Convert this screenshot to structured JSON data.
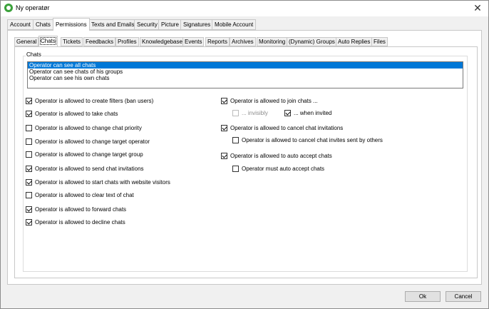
{
  "window": {
    "title": "Ny operatør"
  },
  "tabs": [
    "Account",
    "Chats",
    "Permissions",
    "Texts and Emails",
    "Security",
    "Picture",
    "Signatures",
    "Mobile Account"
  ],
  "subtabs": [
    "General",
    "Chats",
    "Tickets",
    "Feedbacks",
    "Profiles",
    "Knowledgebase",
    "Events",
    "Reports",
    "Archives",
    "Monitoring",
    "(Dynamic) Groups",
    "Auto Replies",
    "Files"
  ],
  "chats_group": {
    "label": "Chats",
    "list": [
      "Operator can see all chats",
      "Operator can see chats of his groups",
      "Operator can see his own chats"
    ],
    "selected_index": 0
  },
  "left_options": [
    {
      "label": "Operator is allowed to create filters (ban users)",
      "checked": true
    },
    {
      "label": "Operator is allowed to take chats",
      "checked": true
    },
    {
      "label": "Operator is allowed to change chat priority",
      "checked": false
    },
    {
      "label": "Operator is allowed to change target operator",
      "checked": false
    },
    {
      "label": "Operator is allowed to change target group",
      "checked": false
    },
    {
      "label": "Operator is allowed to send chat invitations",
      "checked": true
    },
    {
      "label": "Operator is allowed to start chats with website visitors",
      "checked": true
    },
    {
      "label": "Operator is allowed to clear text of chat",
      "checked": false
    },
    {
      "label": "Operator is allowed to forward chats",
      "checked": true
    },
    {
      "label": "Operator is allowed to decline chats",
      "checked": true
    }
  ],
  "right_options": {
    "join_chats": {
      "label": "Operator is allowed to join chats ...",
      "checked": true
    },
    "invisibly": {
      "label": "... invisibly",
      "checked": false,
      "disabled": true
    },
    "when_invited": {
      "label": "... when invited",
      "checked": true
    },
    "cancel_invitations": {
      "label": "Operator is allowed to cancel chat invitations",
      "checked": true
    },
    "cancel_by_others": {
      "label": "Operator is allowed to cancel chat invites sent by others",
      "checked": false
    },
    "auto_accept": {
      "label": "Operator is allowed to auto accept chats",
      "checked": true
    },
    "must_auto_accept": {
      "label": "Operator must auto accept chats",
      "checked": false
    }
  },
  "buttons": {
    "ok": "Ok",
    "cancel": "Cancel"
  }
}
